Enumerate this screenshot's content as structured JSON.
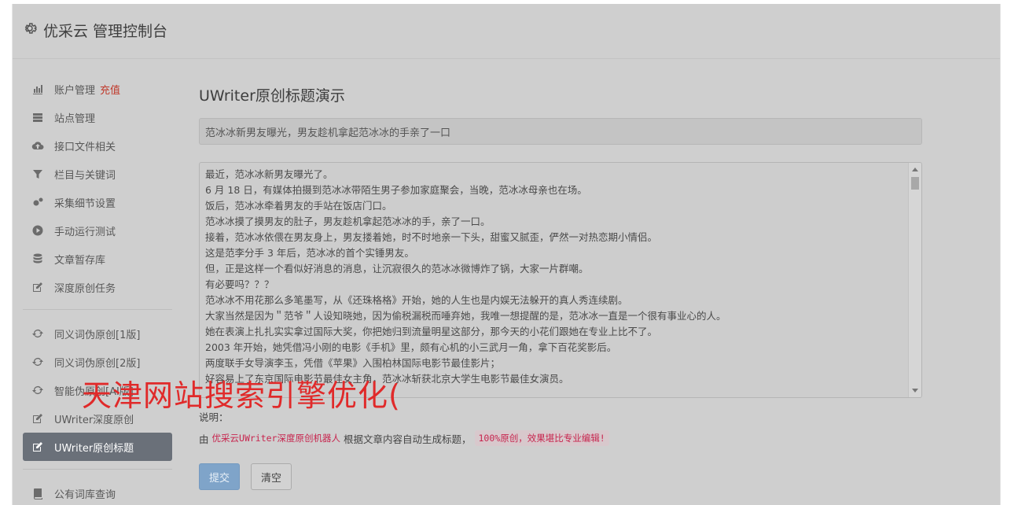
{
  "header": {
    "brand": "优采云 管理控制台",
    "icon": "gear-icon"
  },
  "sidebar": {
    "groups": [
      [
        {
          "label": "账户管理",
          "tag": "充值",
          "icon": "bar-chart-icon"
        },
        {
          "label": "站点管理",
          "icon": "server-icon"
        },
        {
          "label": "接口文件相关",
          "icon": "cloud-upload-icon"
        },
        {
          "label": "栏目与关键词",
          "icon": "filter-icon"
        },
        {
          "label": "采集细节设置",
          "icon": "cogs-icon"
        },
        {
          "label": "手动运行测试",
          "icon": "play-circle-icon"
        },
        {
          "label": "文章暂存库",
          "icon": "database-icon"
        },
        {
          "label": "深度原创任务",
          "icon": "edit-icon"
        }
      ],
      [
        {
          "label": "同义词伪原创[1版]",
          "icon": "refresh-icon"
        },
        {
          "label": "同义词伪原创[2版]",
          "icon": "refresh-icon"
        },
        {
          "label": "智能伪原创[AI版]",
          "icon": "refresh-icon"
        },
        {
          "label": "UWriter深度原创",
          "icon": "edit-icon"
        },
        {
          "label": "UWriter原创标题",
          "icon": "edit-icon",
          "active": true
        }
      ],
      [
        {
          "label": "公有词库查询",
          "icon": "book-icon"
        }
      ]
    ]
  },
  "main": {
    "title": "UWriter原创标题演示",
    "title_value": "范冰冰新男友曝光，男友趁机拿起范冰冰的手亲了一口",
    "body_lines": [
      "最近，范冰冰新男友曝光了。",
      "6 月 18 日，有媒体拍摄到范冰冰带陌生男子参加家庭聚会，当晚，范冰冰母亲也在场。",
      "饭后，范冰冰牵着男友的手站在饭店门口。",
      "范冰冰摸了摸男友的肚子，男友趁机拿起范冰冰的手，亲了一口。",
      "接着，范冰冰依偎在男友身上，男友搂着她，时不时地亲一下头，甜蜜又腻歪，俨然一对热恋期小情侣。",
      "这是范李分手 3 年后，范冰冰的首个实锤男友。",
      "但，正是这样一个看似好消息的消息，让沉寂很久的范冰冰微博炸了锅，大家一片群嘲。",
      "有必要吗？？？",
      "范冰冰不用花那么多笔墨写，从《还珠格格》开始，她的人生也是内娱无法躲开的真人秀连续剧。",
      "大家当然是因为＂范爷＂人设知晓她，因为偷税漏税而唾弃她，我唯一想提醒的是，范冰冰一直是一个很有事业心的人。",
      "她在表演上扎扎实实拿过国际大奖，你把她归到流量明星这部分，那今天的小花们跟她在专业上比不了。",
      "2003 年开始，她凭借冯小刚的电影《手机》里，颇有心机的小三武月一角，拿下百花奖影后。",
      "两度联手女导演李玉，凭借《苹果》入围柏林国际电影节最佳影片；",
      "好容易上了东京国际电影节最佳女主角，范冰冰斩获北京大学生电影节最佳女演员。"
    ],
    "note_label": "说明：",
    "note_prefix": "由",
    "note_code1": "优采云UWriter深度原创机器人",
    "note_mid": "根据文章内容自动生成标题，",
    "note_code2": "100%原创，效果堪比专业编辑!",
    "submit_label": "提交",
    "clear_label": "清空"
  },
  "watermark": "天津网站搜索引擎优化("
}
